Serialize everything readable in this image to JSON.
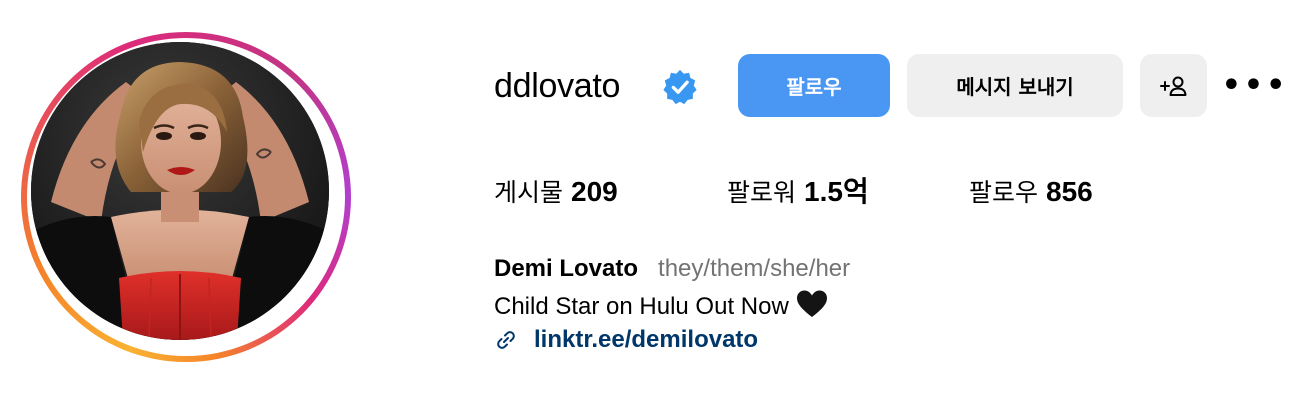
{
  "profile": {
    "username": "ddlovato",
    "verified": true,
    "display_name": "Demi Lovato",
    "pronouns": "they/them/she/her",
    "bio": "Child Star on Hulu Out Now",
    "bio_emoji": "black-heart",
    "link_text": "linktr.ee/demilovato"
  },
  "actions": {
    "follow_label": "팔로우",
    "message_label": "메시지 보내기",
    "add_user_icon": "add-user-icon",
    "more_icon": "more-options-icon",
    "more_glyph": "•••"
  },
  "stats": {
    "posts_label": "게시물",
    "posts_value": "209",
    "followers_label": "팔로워",
    "followers_value": "1.5억",
    "following_label": "팔로우",
    "following_value": "856"
  },
  "colors": {
    "follow_button": "#4a97f3",
    "secondary_button": "#efefef",
    "verified_badge": "#3897f0",
    "link": "#00376b",
    "pronouns": "#737373",
    "story_ring": [
      "#f9b233",
      "#f58529",
      "#dd2a7b",
      "#c13584",
      "#b23fcf"
    ]
  }
}
